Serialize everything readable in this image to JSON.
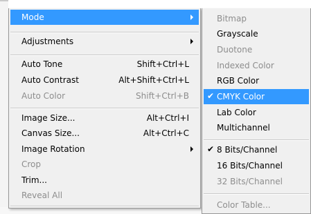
{
  "main_menu": {
    "items": [
      {
        "label": "Mode"
      },
      {
        "label": "Adjustments"
      },
      {
        "label": "Auto Tone",
        "shortcut": "Shift+Ctrl+L"
      },
      {
        "label": "Auto Contrast",
        "shortcut": "Alt+Shift+Ctrl+L"
      },
      {
        "label": "Auto Color",
        "shortcut": "Shift+Ctrl+B"
      },
      {
        "label": "Image Size...",
        "shortcut": "Alt+Ctrl+I"
      },
      {
        "label": "Canvas Size...",
        "shortcut": "Alt+Ctrl+C"
      },
      {
        "label": "Image Rotation"
      },
      {
        "label": "Crop"
      },
      {
        "label": "Trim..."
      },
      {
        "label": "Reveal All"
      }
    ]
  },
  "mode_submenu": {
    "items": [
      {
        "label": "Bitmap"
      },
      {
        "label": "Grayscale"
      },
      {
        "label": "Duotone"
      },
      {
        "label": "Indexed Color"
      },
      {
        "label": "RGB Color"
      },
      {
        "label": "CMYK Color"
      },
      {
        "label": "Lab Color"
      },
      {
        "label": "Multichannel"
      },
      {
        "label": "8 Bits/Channel"
      },
      {
        "label": "16 Bits/Channel"
      },
      {
        "label": "32 Bits/Channel"
      },
      {
        "label": "Color Table..."
      }
    ],
    "check_glyph": "✔"
  },
  "colors": {
    "highlight": "#3399ff",
    "menu_bg": "#f0f0f0",
    "disabled_text": "#8d8d8d"
  }
}
